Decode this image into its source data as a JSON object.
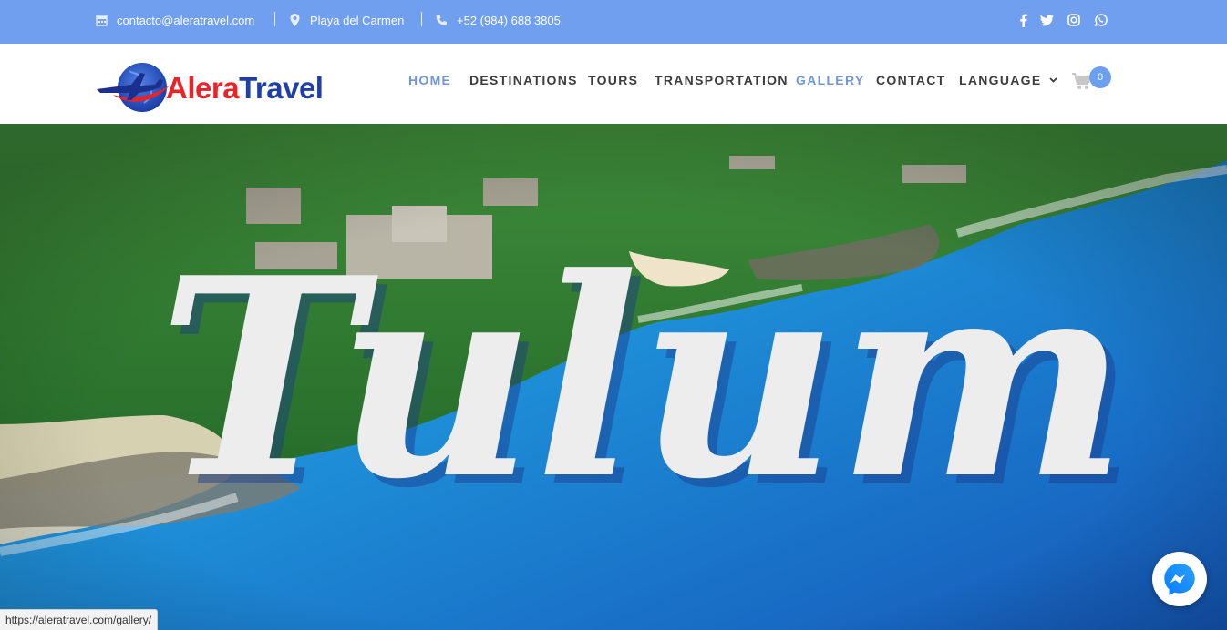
{
  "topbar": {
    "email": "contacto@aleratravel.com",
    "location": "Playa del Carmen",
    "phone": "+52 (984) 688 3805",
    "icons": {
      "email": "calendar-icon",
      "location": "map-pin-icon",
      "phone": "phone-icon"
    },
    "social": [
      "facebook-icon",
      "twitter-icon",
      "instagram-icon",
      "whatsapp-icon"
    ]
  },
  "logo": {
    "part1": "Alera",
    "part2": "Travel"
  },
  "nav": {
    "items": [
      {
        "label": "HOME",
        "active": true
      },
      {
        "label": "DESTINATIONS",
        "active": false
      },
      {
        "label": "TOURS",
        "active": false
      },
      {
        "label": "TRANSPORTATION",
        "active": false
      },
      {
        "label": "GALLERY",
        "active": true
      },
      {
        "label": "CONTACT",
        "active": false
      },
      {
        "label": "LANGUAGE",
        "active": false
      }
    ],
    "cart_count": "0"
  },
  "hero": {
    "title": "Tulum"
  },
  "status_bar": {
    "url": "https://aleratravel.com/gallery/"
  },
  "colors": {
    "topbar": "#719ff0",
    "nav_active": "#6f97d8",
    "ocean": "#1e8fd8",
    "jungle": "#2f7a32"
  }
}
